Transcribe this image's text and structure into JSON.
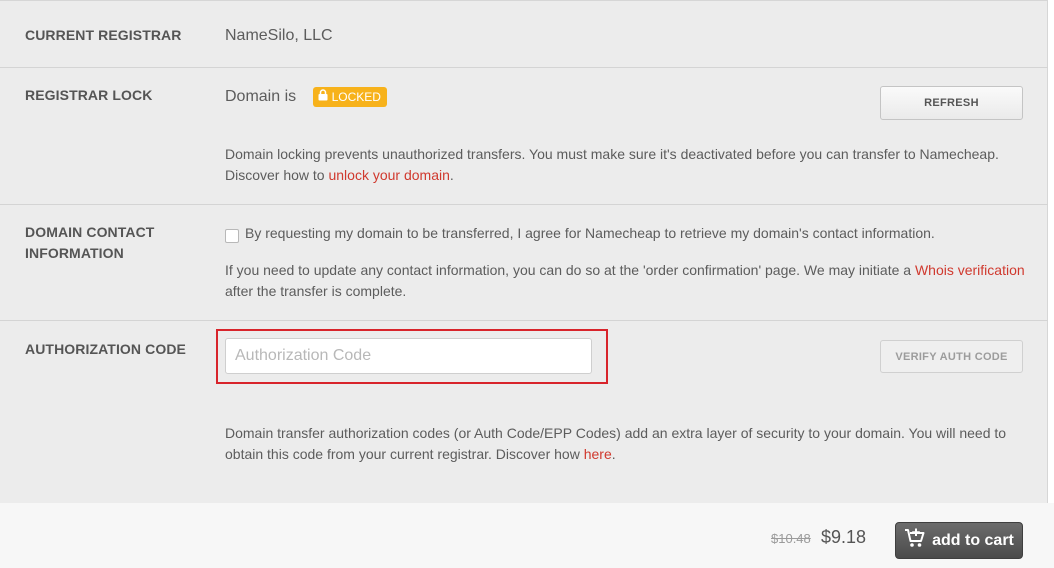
{
  "registrar": {
    "label": "CURRENT REGISTRAR",
    "value": "NameSilo, LLC"
  },
  "lock": {
    "label": "REGISTRAR LOCK",
    "status_prefix": "Domain is",
    "badge_text": "LOCKED",
    "badge_icon": "lock-icon",
    "badge_color": "#f7b21b",
    "refresh_label": "REFRESH",
    "desc_text": "Domain locking prevents unauthorized transfers. You must make sure it's deactivated before you can transfer to Namecheap. Discover how to ",
    "desc_link": "unlock your domain",
    "desc_end": "."
  },
  "contact": {
    "label_line1": "DOMAIN CONTACT",
    "label_line2": "INFORMATION",
    "checkbox_text": "By requesting my domain to be transferred, I agree for Namecheap to retrieve my domain's contact information.",
    "desc_text": "If you need to update any contact information, you can do so at the 'order confirmation' page. We may initiate a ",
    "desc_link": "Whois verification",
    "desc_end": " after the transfer is complete."
  },
  "auth": {
    "label": "AUTHORIZATION CODE",
    "input_placeholder": "Authorization Code",
    "input_value": "",
    "verify_label": "VERIFY AUTH CODE",
    "desc_text": "Domain transfer authorization codes (or Auth Code/EPP Codes) add an extra layer of security to your domain. You will need to obtain this code from your current registrar. Discover how ",
    "desc_link": "here",
    "desc_end": "."
  },
  "footer": {
    "old_price": "$10.48",
    "new_price": "$9.18",
    "cart_label": "add to cart",
    "cart_icon": "cart-plus-icon"
  },
  "colors": {
    "link": "#d0392e",
    "highlight": "#d8242b",
    "panel": "#ececec"
  }
}
